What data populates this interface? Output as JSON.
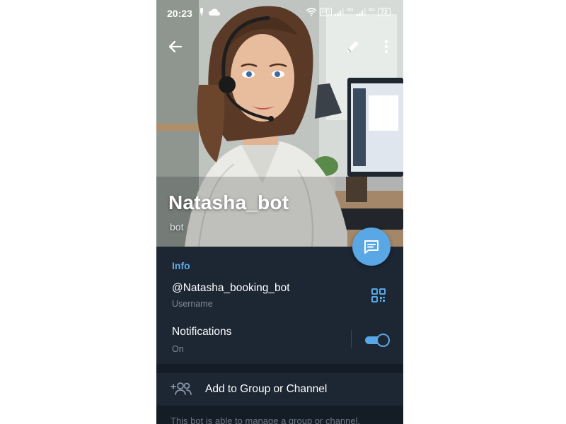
{
  "status_bar": {
    "time": "20:23",
    "hd_badge": "HD",
    "network_1": "4G",
    "network_2": "4G",
    "battery": "72",
    "icons": [
      "mic-icon",
      "cloud-icon",
      "wifi-icon",
      "signal-icon",
      "signal-icon"
    ]
  },
  "top_bar": {
    "back_icon": "arrow-left-icon",
    "edit_icon": "pencil-icon",
    "more_icon": "dots-vertical-icon"
  },
  "profile": {
    "name": "Natasha_bot",
    "status": "bot"
  },
  "fab": {
    "icon": "message-icon"
  },
  "info": {
    "title": "Info",
    "username_value": "@Natasha_booking_bot",
    "username_caption": "Username",
    "qr_icon": "qr-code-icon",
    "notifications_label": "Notifications",
    "notifications_state": "On",
    "notifications_enabled": true
  },
  "actions": {
    "add_to_group_label": "Add to Group or Channel",
    "add_icon": "add-users-icon"
  },
  "footer": {
    "text": "This bot is able to manage a group or channel."
  },
  "colors": {
    "accent": "#5aa7e5",
    "background": "#1c2733",
    "section_gap": "#141c25",
    "secondary_text": "#7d8b99"
  }
}
